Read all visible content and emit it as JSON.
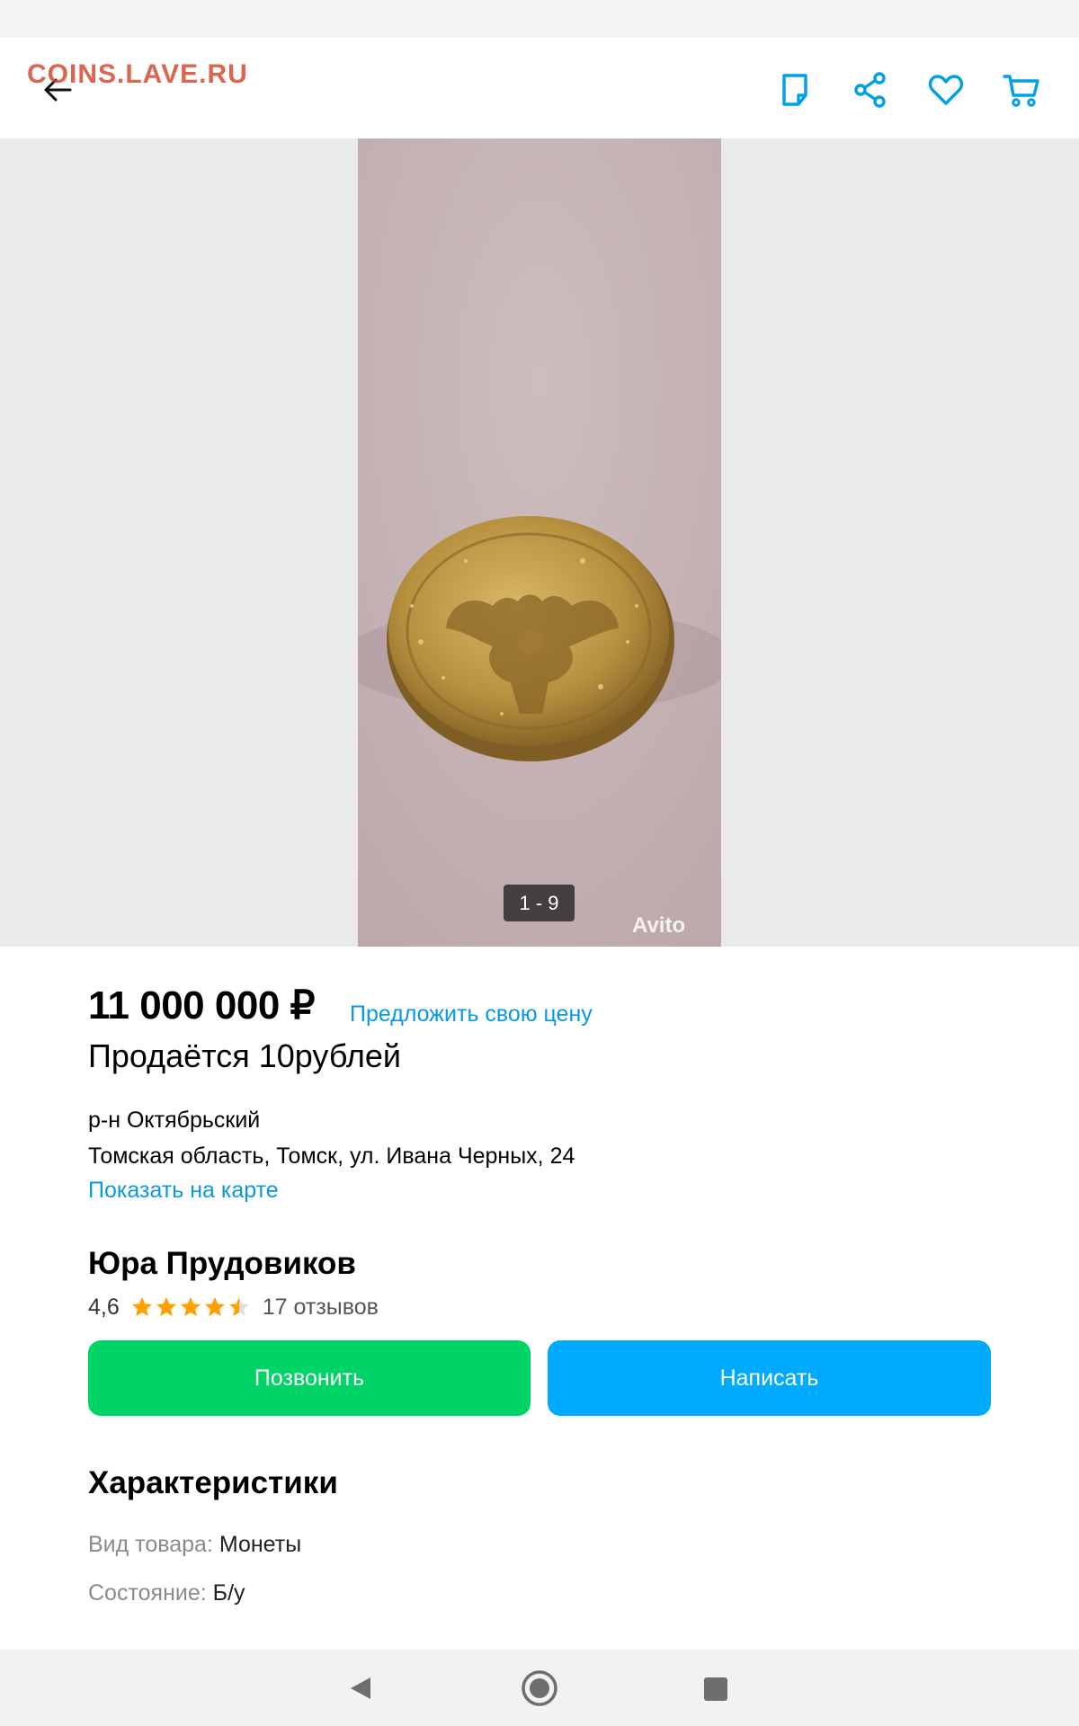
{
  "watermark": "COINS.LAVE.RU",
  "header": {
    "icons": [
      "back-arrow-icon",
      "note-icon",
      "share-icon",
      "heart-icon",
      "cart-icon"
    ],
    "accent": "#00a0e9"
  },
  "gallery": {
    "counter": "1 - 9",
    "avito_label": "Avito"
  },
  "listing": {
    "price": "11 000 000 ₽",
    "offer_link": "Предложить свою цену",
    "title": "Продаётся 10рублей",
    "district": "р-н Октябрьский",
    "address": "Томская область, Томск, ул. Ивана Черных, 24",
    "map_link": "Показать на карте"
  },
  "seller": {
    "name": "Юра Прудовиков",
    "rating": "4,6",
    "stars": 4.5,
    "reviews": "17 отзывов"
  },
  "actions": {
    "call": "Позвонить",
    "write": "Написать",
    "call_color": "#00d467",
    "write_color": "#00aaff"
  },
  "characteristics": {
    "title": "Характеристики",
    "rows": [
      {
        "key": "Вид товара:",
        "value": "Монеты"
      },
      {
        "key": "Состояние:",
        "value": "Б/у"
      }
    ]
  },
  "navbar": {
    "icons": [
      "back-triangle-icon",
      "home-circle-icon",
      "recents-square-icon"
    ]
  }
}
